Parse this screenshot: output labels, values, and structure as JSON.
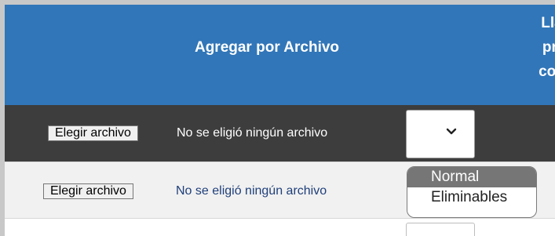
{
  "header": {
    "title": "Agregar por Archivo",
    "cut_lines": [
      "Lla",
      "pri",
      "con"
    ]
  },
  "rows": [
    {
      "file_button_label": "Elegir archivo",
      "file_status": "No se eligió ningún archivo"
    },
    {
      "file_button_label": "Elegir archivo",
      "file_status": "No se eligió ningún archivo"
    }
  ],
  "type_select": {
    "value": "",
    "options": [
      "Normal",
      "Eliminables"
    ],
    "highlighted": "Normal"
  },
  "colors": {
    "header_bg": "#3176b8",
    "row_dark_bg": "#3d3d3d",
    "row_light_bg": "#f1f1f1",
    "row2_status_text": "#1f3f7a",
    "highlight_bg": "#767676"
  },
  "icons": {
    "select_toggle": "chevron-down-icon"
  }
}
